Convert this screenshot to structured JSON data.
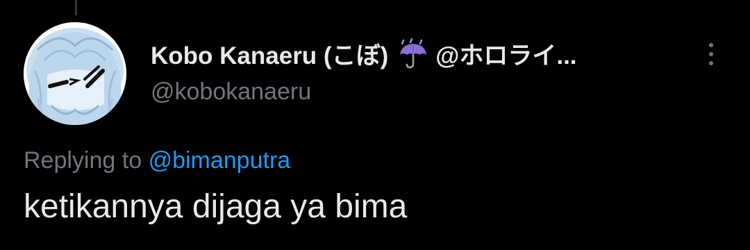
{
  "tweet": {
    "author": {
      "display_name": "Kobo Kanaeru (こぼ)",
      "badge_icon": "umbrella-rain-icon",
      "name_suffix": "@ホロライ...",
      "username": "@kobokanaeru"
    },
    "reply": {
      "prefix": "Replying to",
      "mention": "@bimanputra"
    },
    "text": "ketikannya dijaga ya bima",
    "colors": {
      "background": "#000000",
      "primary_text": "#e7e9ea",
      "secondary_text": "#71767b",
      "link": "#1d9bf0",
      "badge": "#8b6fd6"
    }
  }
}
